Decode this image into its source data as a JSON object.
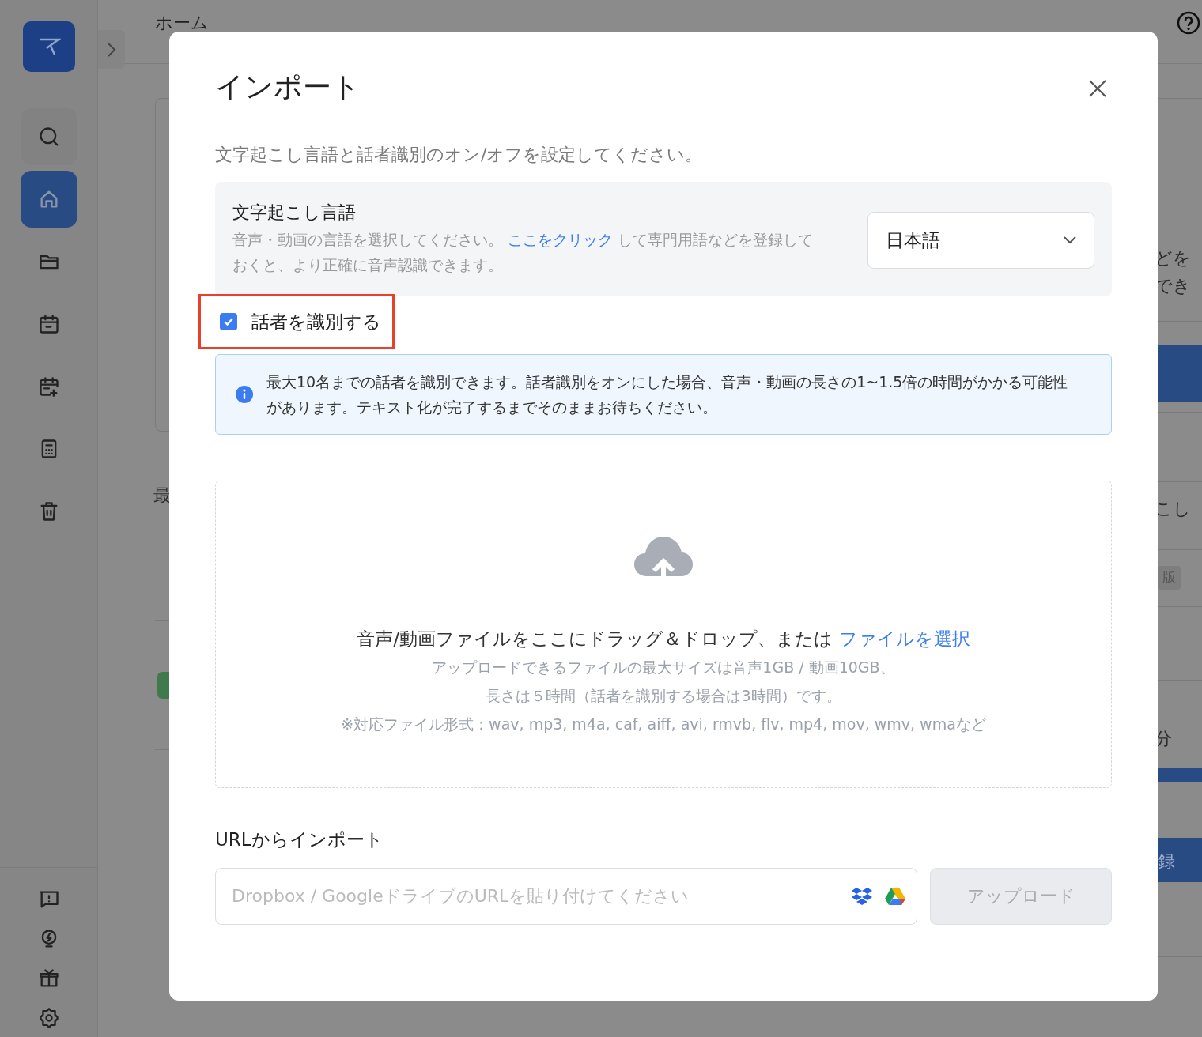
{
  "background": {
    "header_title": "ホーム",
    "sidebar_items": [
      {
        "selected": false
      },
      {
        "selected": true
      },
      {
        "selected": false
      },
      {
        "selected": false
      },
      {
        "selected": false
      },
      {
        "selected": false
      },
      {
        "selected": false
      }
    ],
    "fragments": [
      "どを",
      "でき",
      "こし",
      "版",
      "分",
      "録",
      "最"
    ]
  },
  "dialog": {
    "title": "インポート",
    "subtitle": "文字起こし言語と話者識別のオン/オフを設定してください。",
    "language": {
      "title": "文字起こし言語",
      "description_before": "音声・動画の言語を選択してください。",
      "link": "ここをクリック",
      "description_after": "して専門用語などを登録しておくと、より正確に音声認識できます。",
      "value": "日本語"
    },
    "speaker_id": {
      "label": "話者を識別する",
      "checked": true,
      "highlighted": true
    },
    "info": "最大10名までの話者を識別できます。話者識別をオンにした場合、音声・動画の長さの1~1.5倍の時間がかかる可能性があります。テキスト化が完了するまでそのままお待ちください。",
    "dropzone": {
      "text": "音声/動画ファイルをここにドラッグ＆ドロップ、または",
      "link": "ファイルを選択",
      "notes": [
        "アップロードできるファイルの最大サイズは音声1GB / 動画10GB、",
        "長さは５時間（話者を識別する場合は3時間）です。",
        "※対応ファイル形式：wav, mp3, m4a, caf, aiff, avi, rmvb, flv, mp4, mov, wmv, wmaなど"
      ]
    },
    "url_import": {
      "title": "URLからインポート",
      "placeholder": "Dropbox / GoogleドライブのURLを貼り付けてください",
      "button": "アップロード",
      "button_disabled": true
    }
  }
}
